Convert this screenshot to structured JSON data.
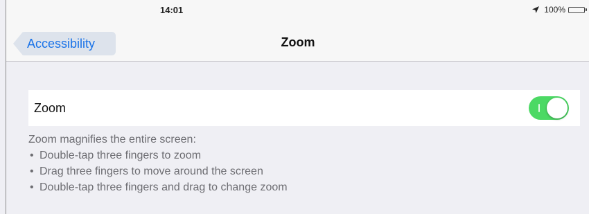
{
  "status_bar": {
    "time": "14:01",
    "battery_text": "100%",
    "battery_color": "#4cd964",
    "location_icon": "location-arrow-icon",
    "battery_icon": "battery-icon"
  },
  "nav": {
    "back_label": "Accessibility",
    "title": "Zoom"
  },
  "settings": {
    "zoom_label": "Zoom",
    "zoom_enabled": true,
    "toggle_color": "#4cd964"
  },
  "footer": {
    "heading": "Zoom magnifies the entire screen:",
    "bullet_char": "•",
    "lines": [
      "Double-tap three fingers to zoom",
      "Drag three fingers to move around the screen",
      "Double-tap three fingers and drag to change zoom"
    ]
  }
}
